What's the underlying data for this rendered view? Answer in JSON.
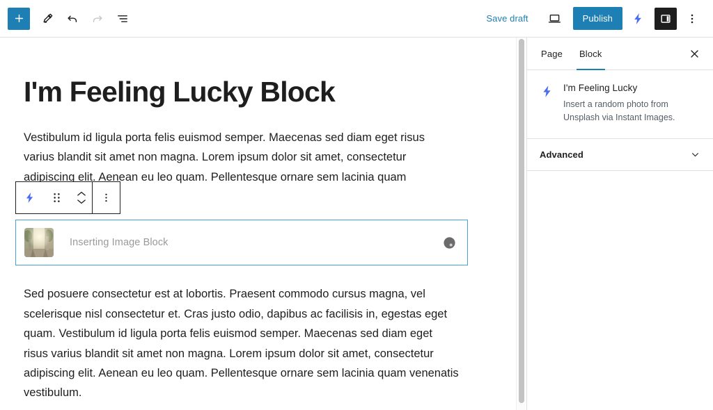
{
  "header": {
    "add_block_label": "+",
    "add_block_icon": "plus-icon",
    "tools_icon": "pencil-edit-icon",
    "undo_icon": "undo-arrow-icon",
    "redo_icon": "redo-arrow-icon",
    "list_view_icon": "document-outline-icon",
    "save_draft_label": "Save draft",
    "preview_icon": "laptop-preview-icon",
    "publish_label": "Publish",
    "instant_images_icon": "lightning-bolt-icon",
    "sidebar_toggle_icon": "settings-panel-icon",
    "more_options_icon": "vertical-ellipsis-icon"
  },
  "editor": {
    "post_title": "I'm Feeling Lucky Block",
    "paragraph_1": "Vestibulum id ligula porta felis euismod semper. Maecenas sed diam eget risus varius blandit sit amet non magna. Lorem ipsum dolor sit amet, consectetur adipiscing elit. Aenean eu leo quam. Pellentesque ornare sem lacinia quam venenatis",
    "paragraph_2": "Sed posuere consectetur est at lobortis. Praesent commodo cursus magna, vel scelerisque nisl consectetur et. Cras justo odio, dapibus ac facilisis in, egestas eget quam. Vestibulum id ligula porta felis euismod semper. Maecenas sed diam eget risus varius blandit sit amet non magna. Lorem ipsum dolor sit amet, consectetur adipiscing elit. Aenean eu leo quam. Pellentesque ornare sem lacinia quam venenatis vestibulum."
  },
  "block_toolbar": {
    "block_type_icon": "lightning-bolt-icon",
    "drag_handle_icon": "six-dot-drag-icon",
    "move_up_icon": "chevron-up-icon",
    "move_down_icon": "chevron-down-icon",
    "options_icon": "vertical-ellipsis-icon"
  },
  "image_block": {
    "thumbnail_icon": "street-photo-thumbnail",
    "status_label": "Inserting Image Block",
    "spinner_icon": "loading-spinner-icon"
  },
  "sidebar": {
    "tabs": [
      {
        "label": "Page",
        "active": false
      },
      {
        "label": "Block",
        "active": true
      }
    ],
    "close_icon": "close-x-icon",
    "block_card": {
      "icon": "lightning-bolt-icon",
      "title": "I'm Feeling Lucky",
      "description": "Insert a random photo from Unsplash via Instant Images."
    },
    "panels": [
      {
        "label": "Advanced",
        "expand_icon": "chevron-down-icon"
      }
    ]
  },
  "colors": {
    "accent_blue": "#1d7fb3",
    "bolt_blue": "#4a6cf0",
    "selection_blue": "#4a9fd4",
    "dark": "#1e1e1e",
    "muted_text": "#9a9a9a"
  }
}
